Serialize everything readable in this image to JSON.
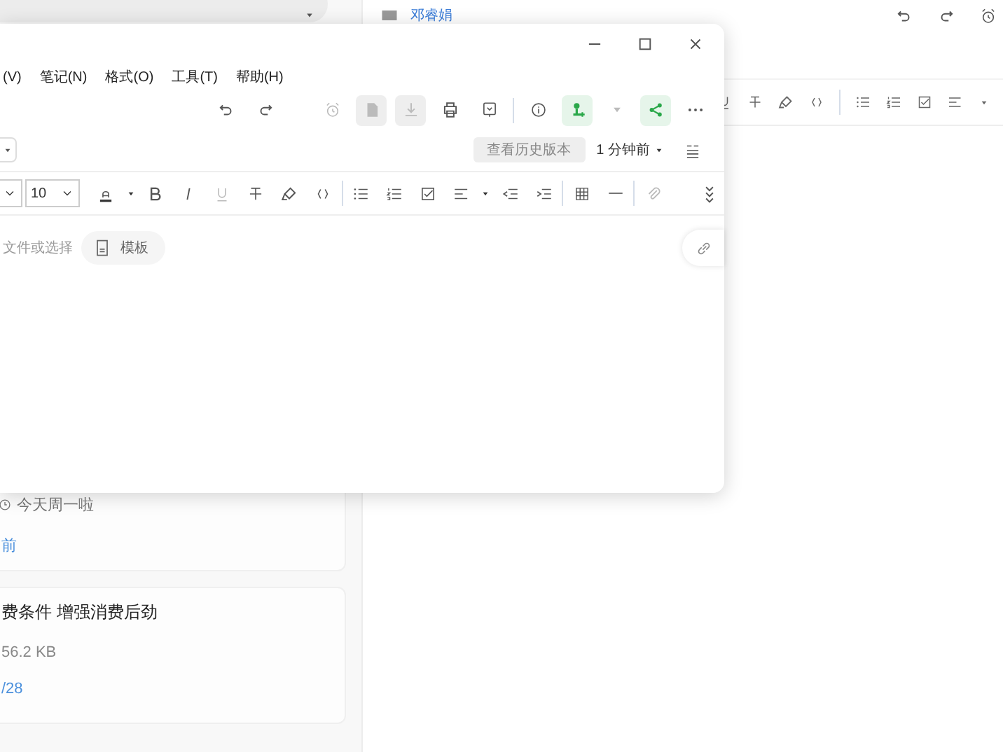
{
  "list_cards": [
    {
      "subtitle": "今天周一啦",
      "date": "前"
    },
    {
      "title": "费条件 增强消费后劲",
      "size": "56.2 KB",
      "date": "/28"
    }
  ],
  "note": {
    "author": "邓睿娟"
  },
  "window": {
    "menu": [
      "(V)",
      "笔记(N)",
      "格式(O)",
      "工具(T)",
      "帮助(H)"
    ],
    "history_button": {
      "label": "查看历史版本",
      "disabled": true
    },
    "saved": "1 分钟前",
    "font_size": "10",
    "attach_hint": "文件或选择",
    "template_button": "模板"
  }
}
